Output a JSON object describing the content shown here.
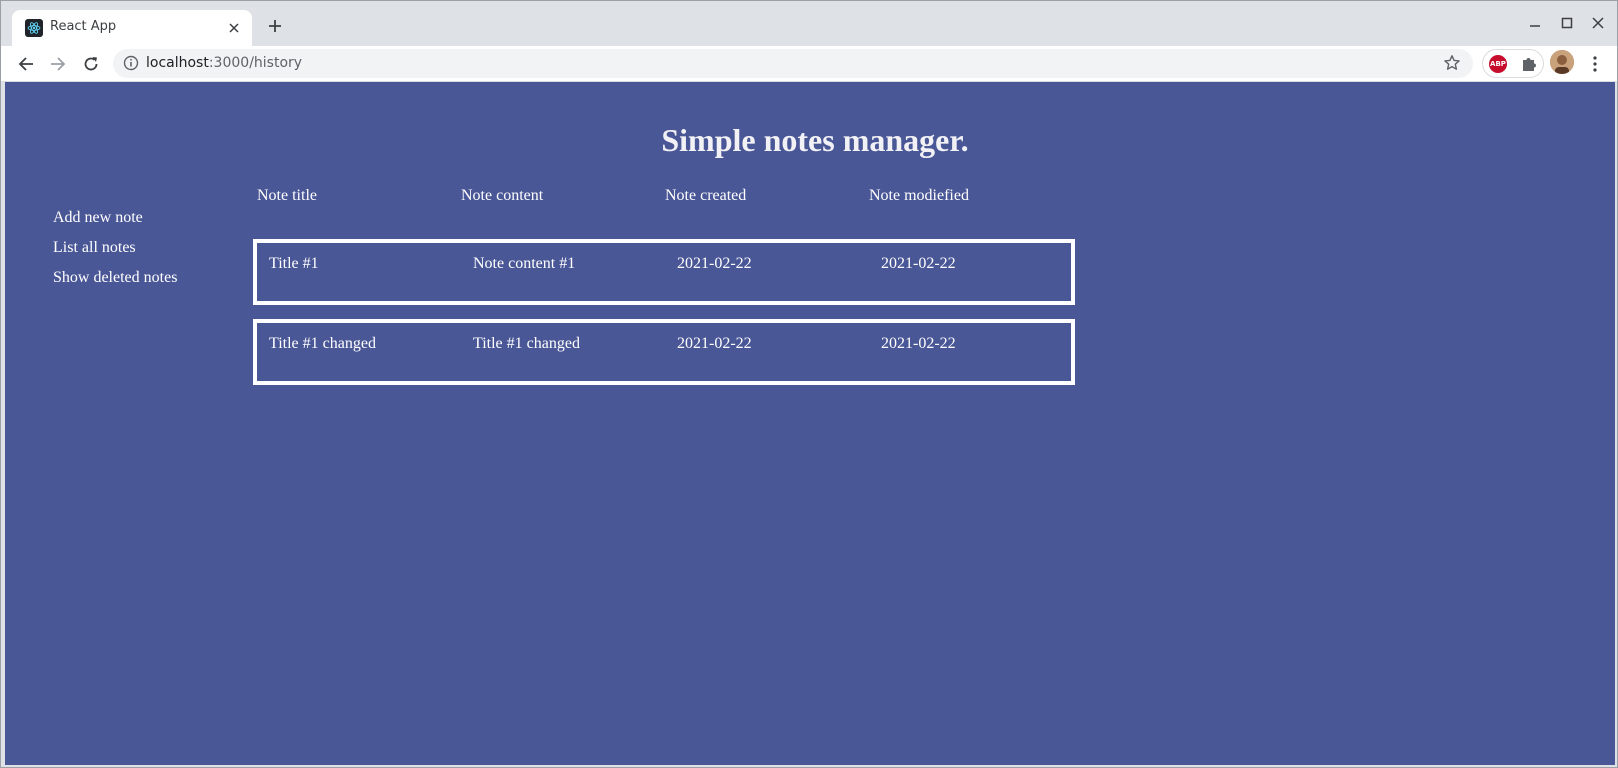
{
  "browser": {
    "tab_title": "React App",
    "url_host": "localhost",
    "url_path": ":3000/history",
    "abp_label": "ABP",
    "icons": {
      "favicon": "react-icon",
      "tab_close": "close-icon",
      "new_tab": "plus-icon",
      "back": "arrow-left-icon",
      "forward": "arrow-right-icon",
      "reload": "reload-icon",
      "info": "info-icon",
      "bookmark": "star-icon",
      "extensions": "puzzle-icon",
      "menu": "kebab-menu-icon",
      "minimize": "minimize-icon",
      "maximize": "maximize-icon",
      "close_window": "close-icon"
    }
  },
  "app": {
    "title": "Simple notes manager.",
    "background_color": "#4a5796",
    "sidebar": {
      "items": [
        {
          "label": "Add new note"
        },
        {
          "label": "List all notes"
        },
        {
          "label": "Show deleted notes"
        }
      ]
    },
    "table": {
      "columns": [
        "Note title",
        "Note content",
        "Note created",
        "Note modiefied"
      ],
      "rows": [
        {
          "title": "Title #1",
          "content": "Note content #1",
          "created": "2021-02-22",
          "modified": "2021-02-22"
        },
        {
          "title": "Title #1 changed",
          "content": "Title #1 changed",
          "created": "2021-02-22",
          "modified": "2021-02-22"
        }
      ]
    }
  }
}
